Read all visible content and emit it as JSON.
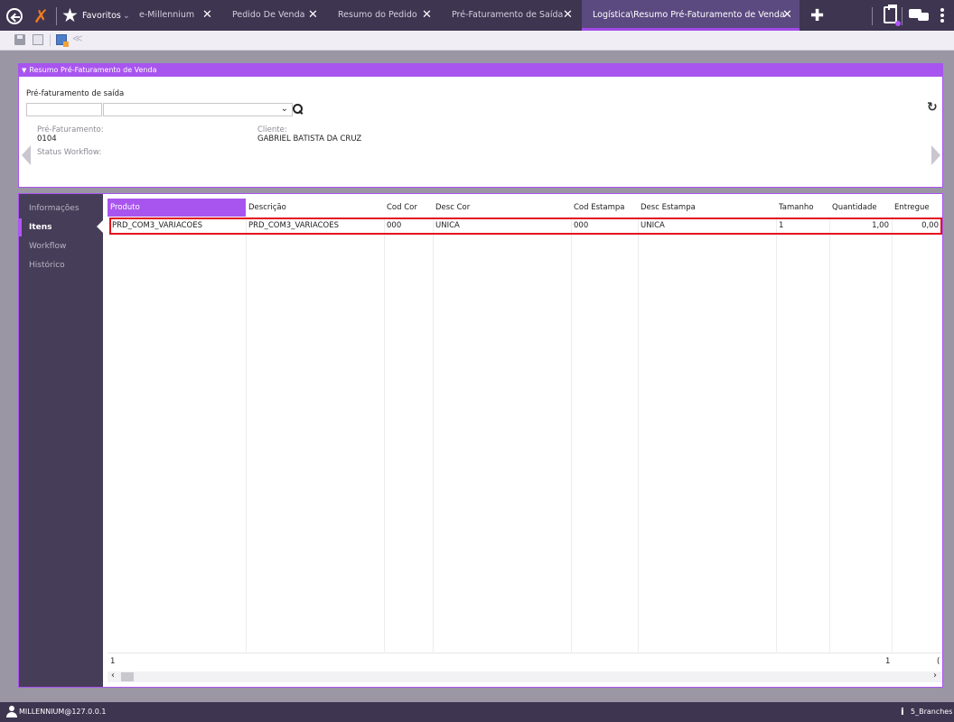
{
  "tabs": {
    "favorites": "Favoritos",
    "items": [
      {
        "label": "e-Millennium"
      },
      {
        "label": "Pedido De Venda"
      },
      {
        "label": "Resumo do Pedido"
      },
      {
        "label": "Pré-Faturamento de Saída"
      },
      {
        "label": "Logística\\Resumo Pré-Faturamento de Venda"
      }
    ]
  },
  "panel": {
    "title": "Resumo Pré-Faturamento de Venda",
    "prefat_label": "Pré-faturamento de saída",
    "field_prefat_label": "Pré-Faturamento:",
    "field_prefat_value": "0104",
    "field_status_label": "Status Workflow:",
    "field_cliente_label": "Cliente:",
    "field_cliente_value": "GABRIEL BATISTA DA CRUZ"
  },
  "sidebar": {
    "items": [
      {
        "label": "Informações"
      },
      {
        "label": "Itens"
      },
      {
        "label": "Workflow"
      },
      {
        "label": "Histórico"
      }
    ]
  },
  "grid": {
    "columns": [
      "Produto",
      "Descrição",
      "Cod Cor",
      "Desc Cor",
      "Cod Estampa",
      "Desc Estampa",
      "Tamanho",
      "Quantidade",
      "Entregue"
    ],
    "rows": [
      [
        "PRD_COM3_VARIACOES",
        "PRD_COM3_VARIACOES",
        "000",
        "UNICA",
        "000",
        "UNICA",
        "1",
        "1,00",
        "0,00"
      ]
    ],
    "footer_count": "1",
    "footer_qty": "1",
    "footer_entregue": "("
  },
  "status": {
    "user": "MILLENNIUM@127.0.0.1",
    "branch": "5_Branches"
  },
  "colors": {
    "accent": "#a855ef",
    "topbar": "#3e3551",
    "sidebar": "#463d58",
    "highlight_row_border": "#e4121c"
  }
}
